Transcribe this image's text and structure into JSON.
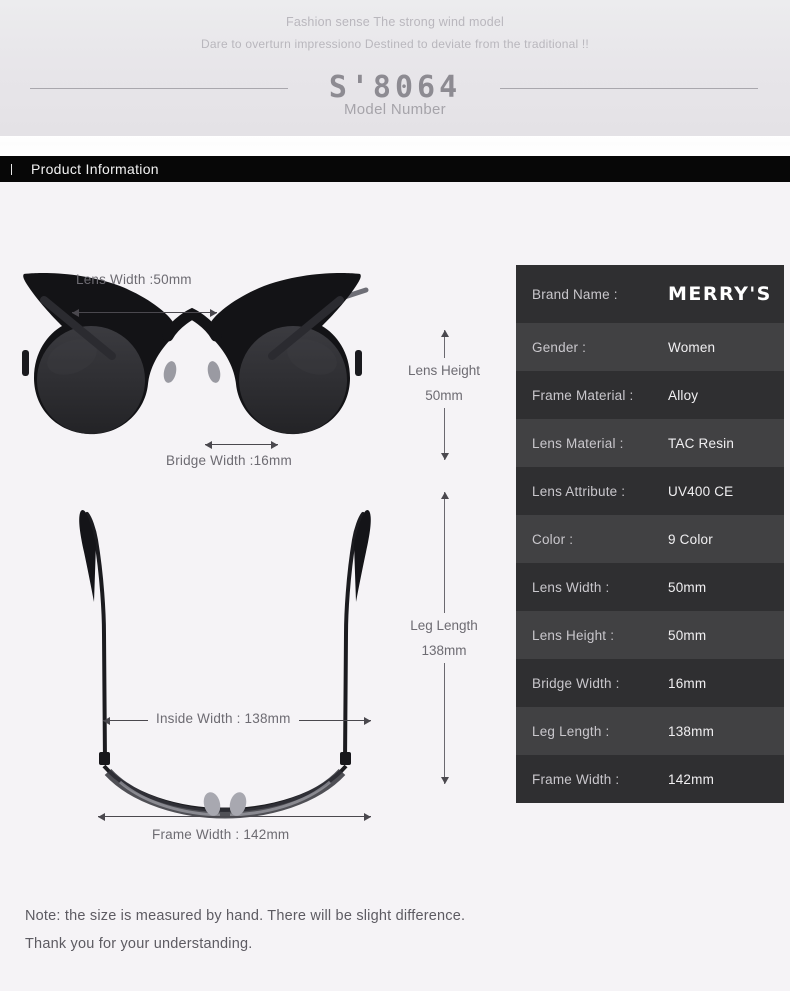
{
  "banner": {
    "tagline_1": "Fashion sense The strong wind model",
    "tagline_2": "Dare to overturn impressiono Destined to deviate from the traditional !!",
    "model_number": "S'8064",
    "model_caption": "Model Number"
  },
  "section": {
    "title": "Product Information"
  },
  "diagram_front": {
    "lens_width_label": "Lens Width :50mm",
    "bridge_width_label": "Bridge Width :16mm",
    "lens_height_label": "Lens Height",
    "lens_height_value": "50mm"
  },
  "diagram_top": {
    "inside_width_label": "Inside  Width : 138mm",
    "frame_width_label": "Frame Width : 142mm",
    "leg_length_label": "Leg Length",
    "leg_length_value": "138mm"
  },
  "spec_table": {
    "rows": [
      {
        "key": "Brand Name :",
        "value": "MERRY'S"
      },
      {
        "key": "Gender :",
        "value": "Women"
      },
      {
        "key": "Frame Material :",
        "value": "Alloy"
      },
      {
        "key": "Lens Material :",
        "value": "TAC Resin"
      },
      {
        "key": "Lens Attribute :",
        "value": "UV400 CE"
      },
      {
        "key": "Color :",
        "value": "9 Color"
      },
      {
        "key": "Lens Width :",
        "value": "50mm"
      },
      {
        "key": "Lens Height :",
        "value": "50mm"
      },
      {
        "key": "Bridge Width :",
        "value": "16mm"
      },
      {
        "key": "Leg Length :",
        "value": "138mm"
      },
      {
        "key": "Frame Width :",
        "value": "142mm"
      }
    ]
  },
  "note": {
    "line_1": "Note: the size is measured by hand. There will be slight difference.",
    "line_2": "Thank you for your understanding."
  },
  "colors": {
    "page_background": "#f5f3f6",
    "banner_background": "#e7e5e9",
    "section_bar": "#070707",
    "row_odd": "#2f2f31",
    "row_even": "#414143",
    "dimension_text": "#6d6b72"
  }
}
